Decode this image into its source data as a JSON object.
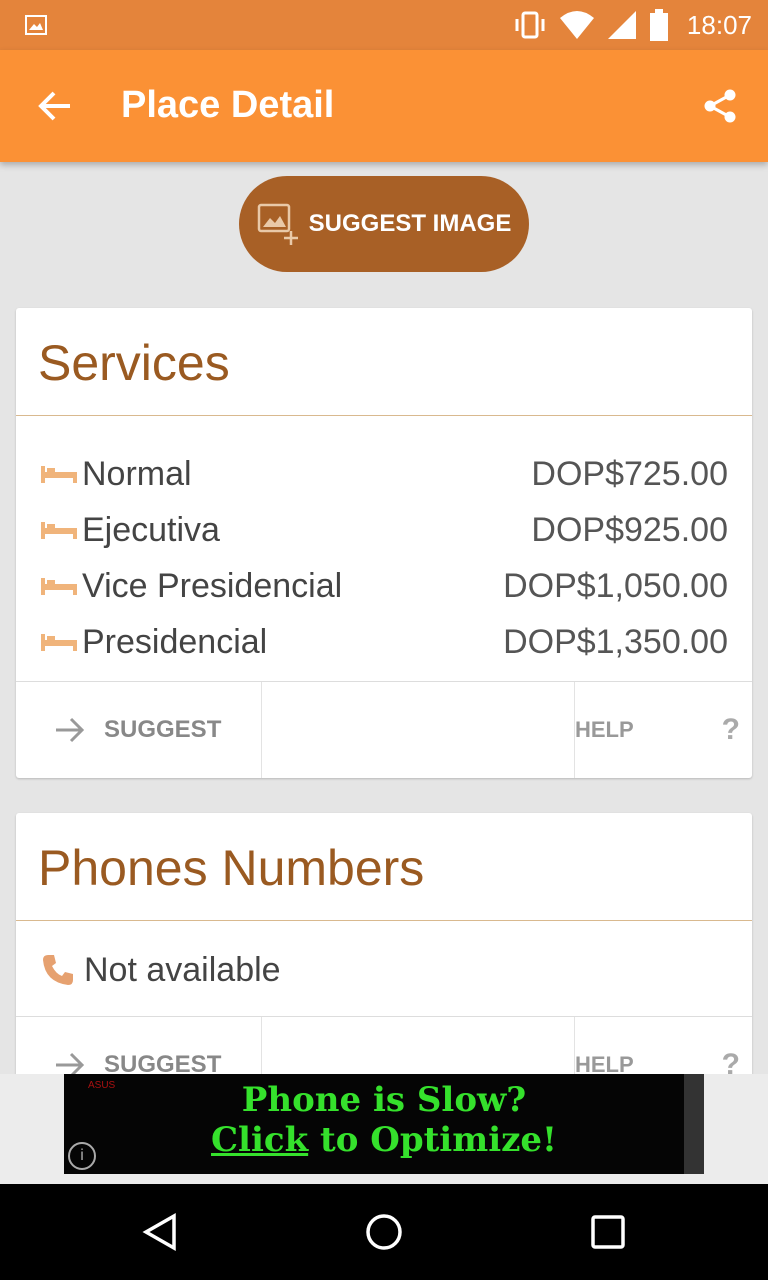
{
  "status_bar": {
    "time": "18:07",
    "icons": [
      "gallery-icon",
      "vibrate-icon",
      "wifi-icon",
      "signal-icon",
      "battery-icon"
    ]
  },
  "app_bar": {
    "title": "Place Detail",
    "back_icon": "arrow-back-icon",
    "share_icon": "share-icon"
  },
  "suggest_image": {
    "label": "SUGGEST IMAGE",
    "icon": "add-image-icon"
  },
  "services": {
    "title": "Services",
    "items": [
      {
        "name": "Normal",
        "price": "DOP$725.00"
      },
      {
        "name": "Ejecutiva",
        "price": "DOP$925.00"
      },
      {
        "name": "Vice Presidencial",
        "price": "DOP$1,050.00"
      },
      {
        "name": "Presidencial",
        "price": "DOP$1,350.00"
      }
    ],
    "suggest_label": "SUGGEST",
    "help_label": "HELP",
    "help_mark": "?"
  },
  "phones": {
    "title": "Phones Numbers",
    "value": "Not available",
    "suggest_label": "SUGGEST",
    "help_label": "HELP",
    "help_mark": "?"
  },
  "ad": {
    "brand": "ASUS",
    "line1": "Phone is Slow?",
    "line2_underlined": "Click",
    "line2_rest": " to Optimize!",
    "info": "i"
  },
  "colors": {
    "status_bar": "#e4843b",
    "app_bar": "#fb9135",
    "accent_brown": "#a86026",
    "title_brown": "#9a5a21",
    "ad_text": "#35e12c"
  }
}
